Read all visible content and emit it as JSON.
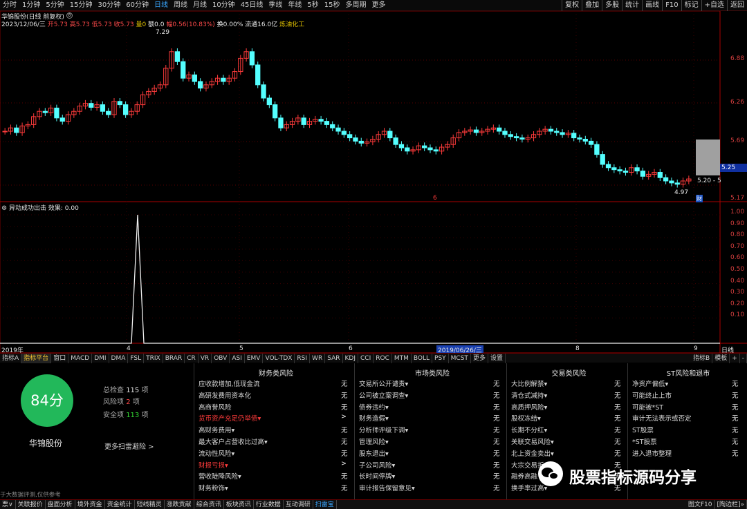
{
  "topbar": {
    "periods": [
      "分时",
      "1分钟",
      "5分钟",
      "15分钟",
      "30分钟",
      "60分钟",
      "日线",
      "周线",
      "月线",
      "10分钟",
      "45日线",
      "季线",
      "年线",
      "5秒",
      "15秒",
      "多周期",
      "更多"
    ],
    "active_period": "日线",
    "tools": [
      "复权",
      "叠加",
      "多股",
      "统计",
      "画线",
      "F10",
      "标记",
      "+自选",
      "返回"
    ]
  },
  "chart": {
    "title": "华锦股份(日线 前复权)",
    "info": {
      "date": "2023/12/06/三",
      "open_label": "开",
      "open": "5.73",
      "high_label": "高",
      "high": "5.73",
      "low_label": "低",
      "low": "5.73",
      "close_label": "收",
      "close": "5.73",
      "vol_label": "量",
      "vol": "0",
      "amt_label": "额",
      "amt": "0.0",
      "chg_label": "幅",
      "chg": "0.56(10.83%)",
      "turn_label": "换",
      "turn": "0.00%",
      "float_label": "流通",
      "float": "16.0亿",
      "sector": "炼油化工"
    },
    "y_ticks": [
      "6.88",
      "6.26",
      "5.69",
      "5.17"
    ],
    "last_price_tag": "5.25",
    "hi_label": "7.29",
    "lo_label": "4.97",
    "cur_range_label": "5.20 - 5",
    "marker_red": "6",
    "badge": "财"
  },
  "indicator": {
    "title": "异动成功出击",
    "eff_label": "效果:",
    "eff_value": "0.00",
    "y_ticks": [
      "1.00",
      "0.90",
      "0.80",
      "0.70",
      "0.60",
      "0.50",
      "0.40",
      "0.30",
      "0.20",
      "0.10"
    ]
  },
  "xaxis": {
    "labels": [
      "2019年",
      "4",
      "5",
      "6",
      "2019/06/26/三",
      "8",
      "9"
    ],
    "mode": "日线"
  },
  "indicator_tabs": {
    "items": [
      "指标A",
      "指标平台",
      "窗口",
      "MACD",
      "DMI",
      "DMA",
      "FSL",
      "TRIX",
      "BRAR",
      "CR",
      "VR",
      "OBV",
      "ASI",
      "EMV",
      "VOL-TDX",
      "RSI",
      "WR",
      "SAR",
      "KDJ",
      "CCI",
      "ROC",
      "MTM",
      "BOLL",
      "PSY",
      "MCST",
      "更多",
      "设置"
    ],
    "active": "指标平台",
    "right": [
      "指标B",
      "模板",
      "+",
      "-"
    ]
  },
  "score": {
    "value": "84分",
    "stock": "华锦股份",
    "total_label": "总检查",
    "total": "115",
    "total_unit": "项",
    "risk_label": "风险项",
    "risk": "2",
    "risk_unit": "项",
    "safe_label": "安全项",
    "safe": "113",
    "safe_unit": "项",
    "more": "更多扫雷避险 >",
    "footer_note": "于大数据评测,仅供参考"
  },
  "risk_cols": [
    {
      "title": "财务类风险",
      "items": [
        {
          "label": "应收款增加,低现金流",
          "val": "无",
          "warn": false
        },
        {
          "label": "高研发费用资本化",
          "val": "无",
          "warn": false
        },
        {
          "label": "高商誉风险",
          "val": "无",
          "warn": false
        },
        {
          "label": "货币资产充足仍举债▾",
          "val": ">",
          "warn": true
        },
        {
          "label": "高财务费用▾",
          "val": "无",
          "warn": false
        },
        {
          "label": "最大客户占营收比过高▾",
          "val": "无",
          "warn": false
        },
        {
          "label": "流动性风险▾",
          "val": "无",
          "warn": false
        },
        {
          "label": "财报亏损▾",
          "val": ">",
          "warn": true
        },
        {
          "label": "营收陡降风险▾",
          "val": "无",
          "warn": false
        },
        {
          "label": "财务粉饰▾",
          "val": "无",
          "warn": false
        }
      ]
    },
    {
      "title": "市场类风险",
      "items": [
        {
          "label": "交易所公开谴责▾",
          "val": "无",
          "warn": false
        },
        {
          "label": "公司被立案调查▾",
          "val": "无",
          "warn": false
        },
        {
          "label": "债券违约▾",
          "val": "无",
          "warn": false
        },
        {
          "label": "财务造假▾",
          "val": "无",
          "warn": false
        },
        {
          "label": "分析师评级下调▾",
          "val": "无",
          "warn": false
        },
        {
          "label": "管理风险▾",
          "val": "无",
          "warn": false
        },
        {
          "label": "股东退出▾",
          "val": "无",
          "warn": false
        },
        {
          "label": "子公司风险▾",
          "val": "无",
          "warn": false
        },
        {
          "label": "长时间停牌▾",
          "val": "无",
          "warn": false
        },
        {
          "label": "审计报告保留意见▾",
          "val": "无",
          "warn": false
        }
      ]
    },
    {
      "title": "交易类风险",
      "items": [
        {
          "label": "大比例解禁▾",
          "val": "无",
          "warn": false
        },
        {
          "label": "清仓式减持▾",
          "val": "无",
          "warn": false
        },
        {
          "label": "高质押风险▾",
          "val": "无",
          "warn": false
        },
        {
          "label": "股权冻结▾",
          "val": "无",
          "warn": false
        },
        {
          "label": "长期不分红▾",
          "val": "无",
          "warn": false
        },
        {
          "label": "关联交易风险▾",
          "val": "无",
          "warn": false
        },
        {
          "label": "北上资金卖出▾",
          "val": "无",
          "warn": false
        },
        {
          "label": "大宗交易折",
          "val": "无",
          "warn": false
        },
        {
          "label": "融券高融",
          "val": "无",
          "warn": false
        },
        {
          "label": "换手率过高▾",
          "val": "无",
          "warn": false
        }
      ]
    },
    {
      "title": "ST风险和退市",
      "items": [
        {
          "label": "净资产偏低▾",
          "val": "无",
          "warn": false
        },
        {
          "label": "可能终止上市",
          "val": "无",
          "warn": false
        },
        {
          "label": "可能被*ST",
          "val": "无",
          "warn": false
        },
        {
          "label": "审计无法表示或否定",
          "val": "无",
          "warn": false
        },
        {
          "label": "ST股票",
          "val": "无",
          "warn": false
        },
        {
          "label": "*ST股票",
          "val": "无",
          "warn": false
        },
        {
          "label": "进入退市整理",
          "val": "无",
          "warn": false
        }
      ]
    }
  ],
  "watermark": "股票指标源码分享",
  "bottom_tabs": {
    "items": [
      "票∨",
      "关联报价",
      "盘面分析",
      "境外资金",
      "资金统计",
      "短线精灵",
      "涨跌贡献",
      "综合资讯",
      "板块资讯",
      "行业数据",
      "互动调研",
      "扫雷宝"
    ],
    "active": "扫雷宝",
    "right": [
      "图文F10",
      "[陶边栏]»"
    ]
  },
  "colors": {
    "up": "#ff3b3b",
    "down": "#54ffff",
    "accent": "#3aa7ff",
    "score_bg": "#22b85a",
    "warn": "#ff3b3b"
  }
}
